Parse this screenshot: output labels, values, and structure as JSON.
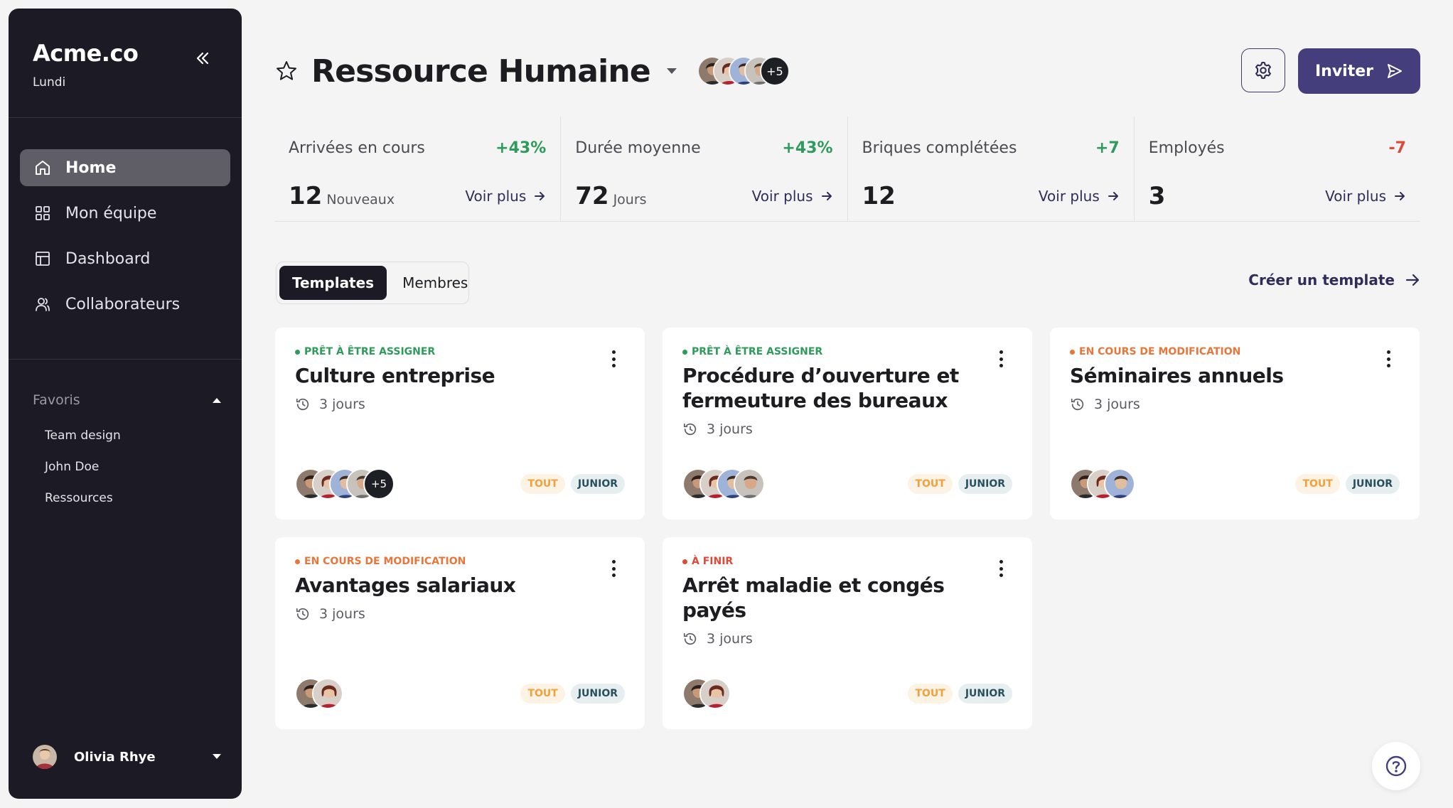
{
  "colors": {
    "sidebar_bg": "#1c1b25",
    "accent": "#443f7c",
    "positive": "#2e9b5b",
    "negative": "#dd4a38",
    "status_ready": "#2e9b5b",
    "status_editing": "#e8763a",
    "status_finish": "#dd4a38"
  },
  "sidebar": {
    "brand": "Acme.co",
    "subtitle": "Lundi",
    "nav": [
      {
        "label": "Home",
        "icon": "home-icon",
        "active": true
      },
      {
        "label": "Mon équipe",
        "icon": "grid-icon",
        "active": false
      },
      {
        "label": "Dashboard",
        "icon": "layout-icon",
        "active": false
      },
      {
        "label": "Collaborateurs",
        "icon": "users-icon",
        "active": false
      }
    ],
    "favorites_label": "Favoris",
    "favorites": [
      "Team design",
      "John Doe",
      "Ressources"
    ],
    "user_name": "Olivia Rhye"
  },
  "header": {
    "title": "Ressource Humaine",
    "more_count": "+5",
    "invite_label": "Inviter"
  },
  "stats": [
    {
      "label": "Arrivées en cours",
      "delta": "+43%",
      "value": "12",
      "unit": "Nouveaux",
      "link": "Voir plus"
    },
    {
      "label": "Durée moyenne",
      "delta": "+43%",
      "value": "72",
      "unit": "Jours",
      "link": "Voir plus"
    },
    {
      "label": "Briques complétées",
      "delta": "+7",
      "value": "12",
      "unit": "",
      "link": "Voir plus"
    },
    {
      "label": "Employés",
      "delta": "-7",
      "value": "3",
      "unit": "",
      "link": "Voir plus"
    }
  ],
  "tabs": [
    "Templates",
    "Membres"
  ],
  "create_link": "Créer un template",
  "cards": [
    {
      "status": "PRÊT À ÊTRE ASSIGNER",
      "status_kind": "ready",
      "title": "Culture entreprise",
      "duration": "3 jours",
      "more": "+5",
      "tags": [
        "TOUT",
        "JUNIOR"
      ]
    },
    {
      "status": "PRÊT À ÊTRE ASSIGNER",
      "status_kind": "ready",
      "title": "Procédure d’ouverture et fermeuture des bureaux",
      "duration": "3 jours",
      "more": "",
      "tags": [
        "TOUT",
        "JUNIOR"
      ]
    },
    {
      "status": "EN COURS DE MODIFICATION",
      "status_kind": "editing",
      "title": "Séminaires annuels",
      "duration": "3 jours",
      "more": "",
      "tags": [
        "TOUT",
        "JUNIOR"
      ]
    },
    {
      "status": "EN COURS DE MODIFICATION",
      "status_kind": "editing",
      "title": "Avantages salariaux",
      "duration": "3 jours",
      "more": "",
      "tags": [
        "TOUT",
        "JUNIOR"
      ]
    },
    {
      "status": "À FINIR",
      "status_kind": "finish",
      "title": "Arrêt maladie et congés payés",
      "duration": "3 jours",
      "more": "",
      "tags": [
        "TOUT",
        "JUNIOR"
      ]
    }
  ]
}
